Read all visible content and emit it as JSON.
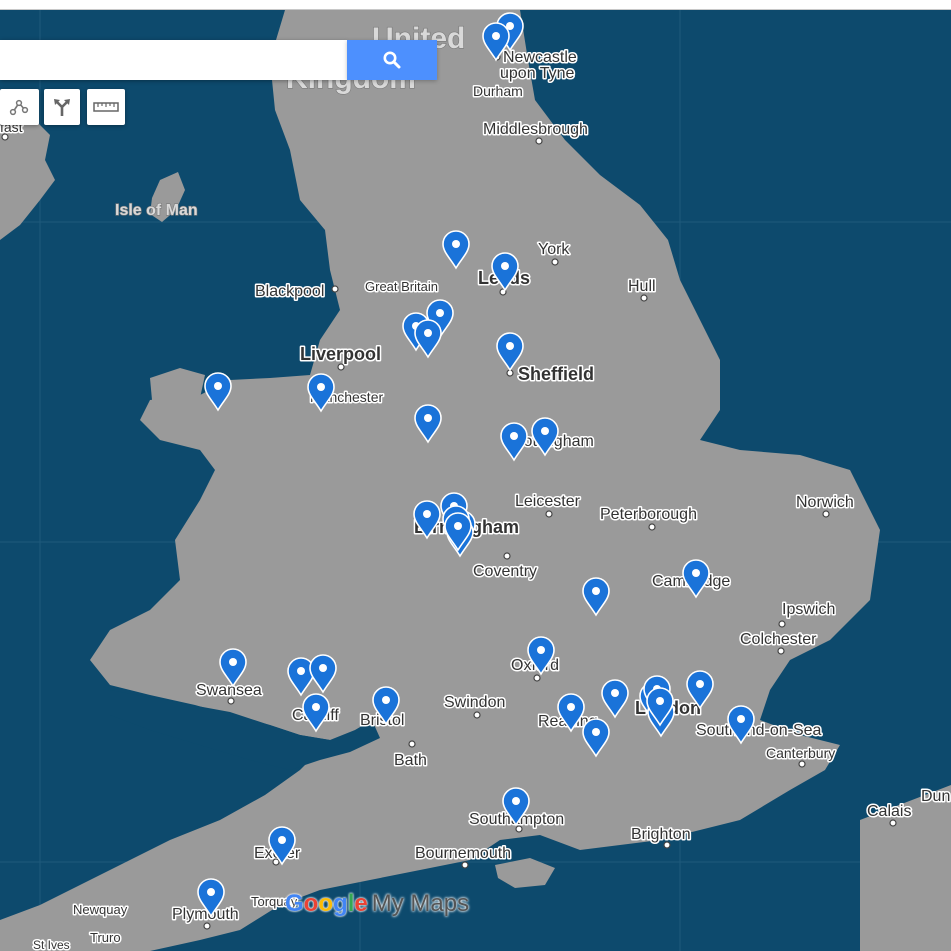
{
  "search": {
    "placeholder": "",
    "value": ""
  },
  "toolbar": {
    "items": [
      {
        "name": "draw-line",
        "icon": "polyline-icon"
      },
      {
        "name": "directions",
        "icon": "route-icon"
      },
      {
        "name": "measure",
        "icon": "ruler-icon"
      }
    ]
  },
  "map": {
    "country_label_line1": "United",
    "country_label_line2": "Kingdom",
    "land_color": "#9a9a9a",
    "water_color": "#0d4a6d",
    "marker_color": "#1a73d9",
    "places": {
      "newcastle_1": "Newcastle",
      "newcastle_2": "upon Tyne",
      "durham": "Durham",
      "middlesbrough": "Middlesbrough",
      "isle_of_man": "Isle of Man",
      "york": "York",
      "leeds": "Leeds",
      "hull": "Hull",
      "blackpool": "Blackpool",
      "great_britain": "Great Britain",
      "liverpool": "Liverpool",
      "manchester": "Manchester",
      "sheffield": "Sheffield",
      "nottingham": "Nottingham",
      "leicester": "Leicester",
      "peterborough": "Peterborough",
      "norwich": "Norwich",
      "birmingham": "Birmingham",
      "coventry": "Coventry",
      "cambridge": "Cambridge",
      "ipswich": "Ipswich",
      "colchester": "Colchester",
      "swansea": "Swansea",
      "cardiff": "Cardiff",
      "bristol": "Bristol",
      "swindon": "Swindon",
      "oxford": "Oxford",
      "reading": "Reading",
      "london": "London",
      "southend": "Southend-on-Sea",
      "canterbury": "Canterbury",
      "bath": "Bath",
      "calais": "Calais",
      "dunkirk": "Dun",
      "southampton": "Southampton",
      "brighton": "Brighton",
      "bournemouth": "Bournemouth",
      "exeter": "Exeter",
      "torquay": "Torquay",
      "newquay": "Newquay",
      "plymouth": "Plymouth",
      "truro": "Truro",
      "st_ives": "St Ives",
      "belfast": "fast"
    },
    "marker_count": 39
  },
  "branding": {
    "g1": "G",
    "o1": "o",
    "o2": "o",
    "g2": "g",
    "l": "l",
    "e": "e",
    "suffix": "My Maps"
  }
}
